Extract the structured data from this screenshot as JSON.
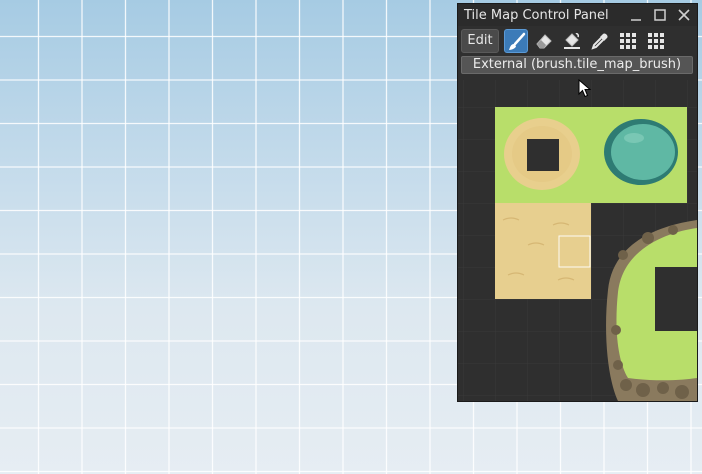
{
  "window": {
    "title": "Tile Map Control Panel",
    "minimize_icon": "minimize-icon",
    "maximize_icon": "maximize-icon",
    "close_icon": "close-icon"
  },
  "toolbar": {
    "edit_label": "Edit",
    "tools": [
      {
        "name": "brush-icon",
        "active": true
      },
      {
        "name": "eraser-icon",
        "active": false
      },
      {
        "name": "paint-bucket-icon",
        "active": false
      },
      {
        "name": "eyedropper-icon",
        "active": false
      },
      {
        "name": "grid-icon",
        "active": false
      },
      {
        "name": "grid-icon",
        "active": false
      }
    ]
  },
  "brush_selector": {
    "value": "External (brush.tile_map_brush)"
  },
  "colors": {
    "panel_bg": "#2f2f2f",
    "active_tool": "#3c7bb8",
    "sky_top": "#a6cbe3",
    "sky_bottom": "#e6edf3",
    "grass": "#b8de6a",
    "sand": "#e7cf8f",
    "water": "#5fb8a4",
    "rock": "#8a7a5e"
  }
}
